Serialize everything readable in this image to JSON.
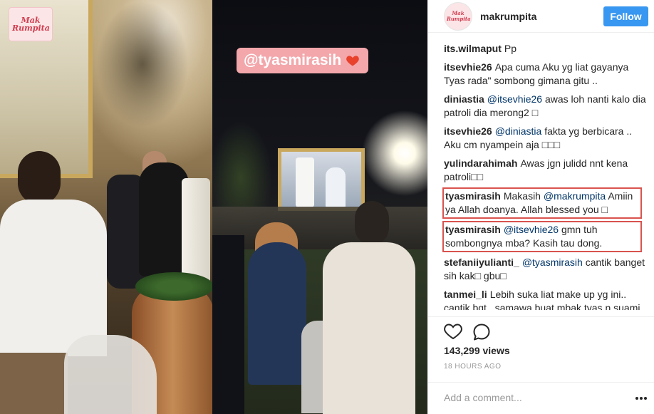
{
  "media": {
    "logo_text": "Mak Rumpita",
    "sticker_text": "@tyasmirasih",
    "sticker_color": "#f3a7ab",
    "heart_color": "#e8412c"
  },
  "post": {
    "username": "makrumpita",
    "avatar_text": "Mak Rumpita",
    "follow_label": "Follow",
    "follow_color": "#3897f0"
  },
  "comments": [
    {
      "user": "its.wilmaput",
      "text": "Pp"
    },
    {
      "user": "itsevhie26",
      "text": "Apa cuma Aku yg liat gayanya Tyas rada\" sombong gimana gitu .."
    },
    {
      "user": "diniastia",
      "mention": "@itsevhie26",
      "text": "awas loh nanti kalo dia patroli dia merong2 □"
    },
    {
      "user": "itsevhie26",
      "mention": "@diniastia",
      "text": "fakta yg berbicara .. Aku cm nyampein aja □□□"
    },
    {
      "user": "yulindarahimah",
      "text": "Awas jgn julidd nnt kena patroli□□"
    },
    {
      "user": "tyasmirasih",
      "text_pre": "Makasih",
      "mention": "@makrumpita",
      "text": "Amiin ya Allah doanya. Allah blessed you □",
      "highlighted": true
    },
    {
      "user": "tyasmirasih",
      "mention": "@itsevhie26",
      "text": "gmn tuh sombongnya mba? Kasih tau dong.",
      "highlighted": true
    },
    {
      "user": "stefaniiyulianti_",
      "mention": "@tyasmirasih",
      "text": "cantik banget sih kak□ gbu□"
    },
    {
      "user": "tanmei_li",
      "text": "Lebih suka liat make up yg ini.. cantik bgt.. samawa buat mbak tyas n suami."
    }
  ],
  "highlight_color": "#d9534f",
  "actions": {
    "like_icon": "heart-outline-icon",
    "comment_icon": "speech-bubble-icon",
    "views": "143,299 views",
    "time": "18 HOURS AGO"
  },
  "add_comment": {
    "placeholder": "Add a comment...",
    "more_icon": "more-options-icon"
  }
}
